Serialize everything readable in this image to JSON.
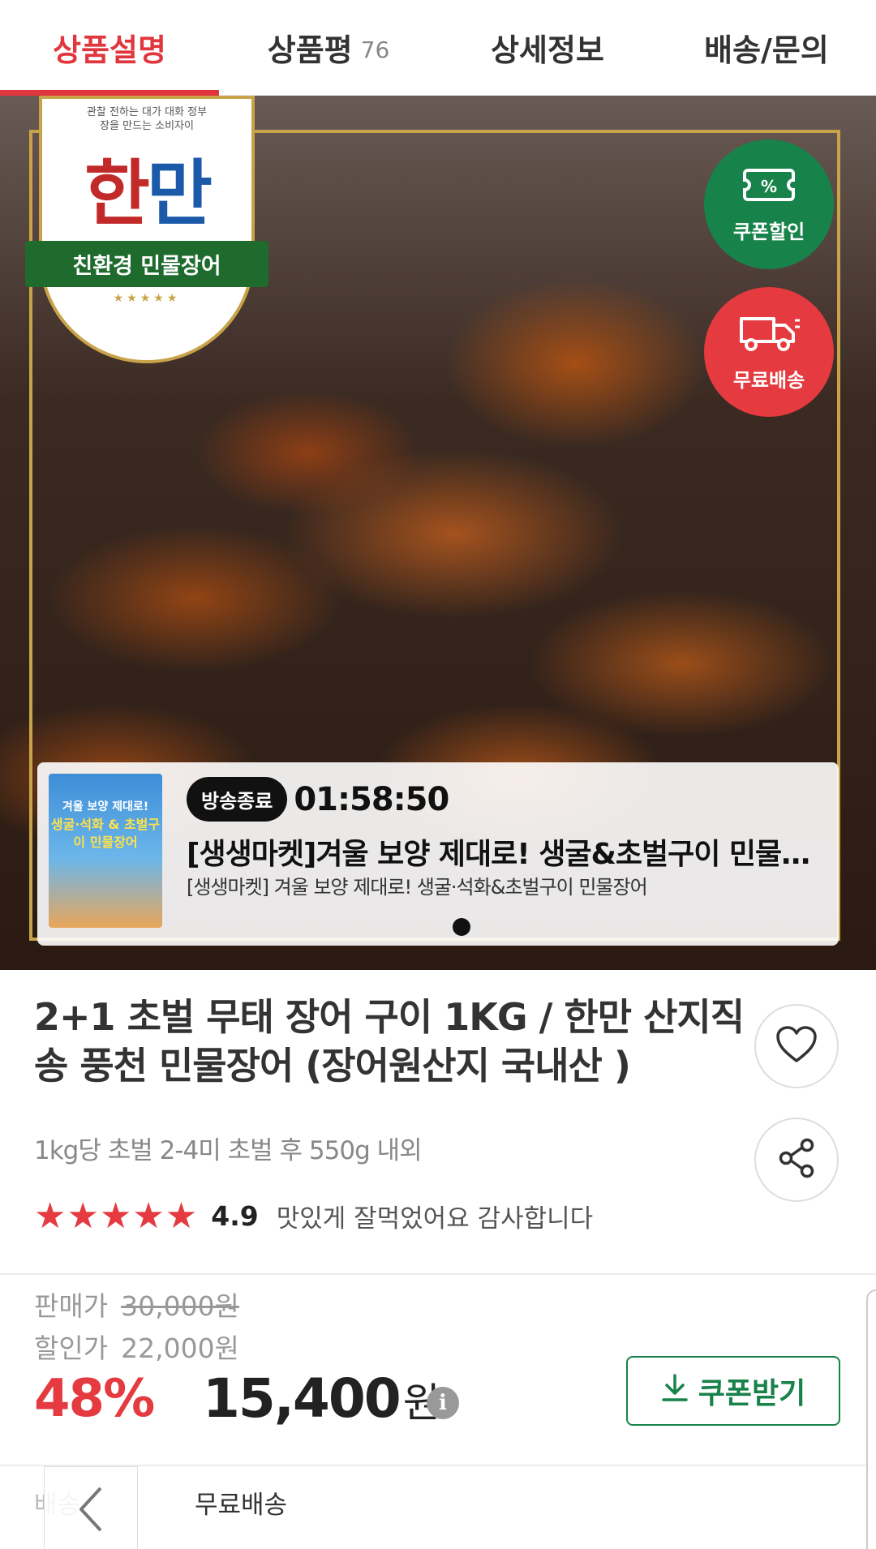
{
  "tabs": [
    {
      "label": "상품설명",
      "active": true
    },
    {
      "label": "상품평",
      "count": "76"
    },
    {
      "label": "상세정보"
    },
    {
      "label": "배송/문의"
    }
  ],
  "hero": {
    "logo": {
      "tagline_line1": "관찰 전하는 대가 대화 정부",
      "tagline_line2": "장을 만드는 소비자이",
      "main_part1": "한",
      "main_part2": "만",
      "ribbon": "친환경 민물장어",
      "stars": "★★★★★"
    },
    "coupon_badge": {
      "label": "쿠폰할인",
      "icon": "percent-ticket-icon"
    },
    "delivery_badge": {
      "label": "무료배송",
      "icon": "truck-icon"
    }
  },
  "live": {
    "thumbnail_line1": "겨울 보양 제대로!",
    "thumbnail_line2": "생굴·석화 & 초벌구이 민물장어",
    "status": "방송종료",
    "timer": "01:58:50",
    "title": "[생생마켓]겨울 보양 제대로! 생굴&초벌구이 민물장어",
    "subtitle": "[생생마켓] 겨울 보양 제대로! 생굴·석화&초벌구이 민물장어"
  },
  "product": {
    "title": "2+1 초벌 무태 장어 구이 1KG / 한만 산지직송 풍천 민물장어 (장어원산지 국내산 )",
    "subtitle": "1kg당 초벌 2-4미 초벌 후 550g 내외",
    "stars": "★★★★★",
    "rating": "4.9",
    "review_snippet": "맛있게 잘먹었어요 감사합니다"
  },
  "price": {
    "sale_label": "판매가",
    "sale_value": "30,000원",
    "discount_label": "할인가",
    "discount_value": "22,000원",
    "discount_rate": "48%",
    "final_value": "15,400",
    "final_unit": "원",
    "info_icon": "i",
    "coupon_button": "쿠폰받기"
  },
  "shipping": {
    "label": "배송",
    "value": "무료배송"
  },
  "colors": {
    "accent_red": "#e0363e",
    "accent_green": "#17824a"
  }
}
